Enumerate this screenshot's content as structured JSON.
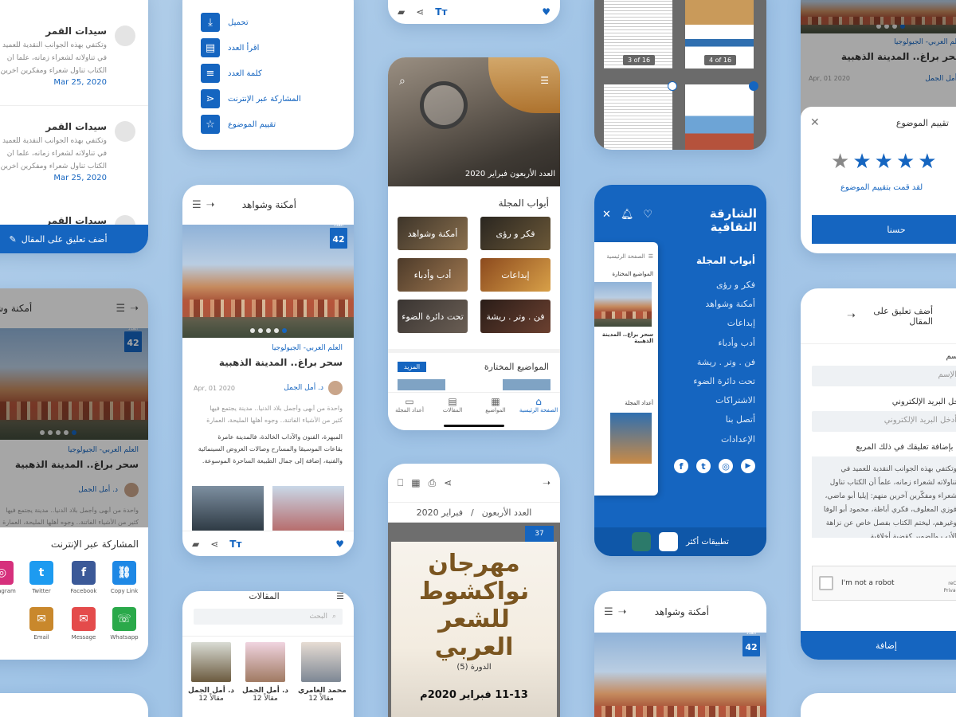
{
  "comments_card": {
    "comments": [
      {
        "name": "سيدات القمر",
        "text1": "وتكتفي بهذه الجوانب النقدية للعميد في",
        "text2": "في تناولاته لشعراء زمانه، علماً أن",
        "text3": "الكتاب تناول شعراء ومفكّرين آخرين",
        "date": "Mar 25, 2020"
      },
      {
        "name": "سيدات القمر",
        "text1": "وتكتفي بهذه الجوانب النقدية للعميد في",
        "text2": "في تناولاته لشعراء زمانه، علماً أن",
        "text3": "الكتاب تناول شعراء ومفكّرين آخرين",
        "date": "Mar 25, 2020"
      },
      {
        "name": "سيدات القمر"
      }
    ],
    "add_comment": "أضف تعليق على المقال"
  },
  "menu_card": {
    "items": [
      "تحميل",
      "اقرأ العدد",
      "كلمة العدد",
      "المشاركة عبر الإنترنت",
      "تقييم الموضوع"
    ]
  },
  "article_card": {
    "title": "أمكنة وشواهد",
    "badge_label": "العدد",
    "badge_number": "42",
    "category": "العلم العربي- الجيولوجيا",
    "headline": "سحر براغ.. المدينة الذهبية",
    "date": "Apr, 01 2020",
    "author": "د. أمل الجمل",
    "p1": "واحدة من أبهى وأجمل بلاد الدنيا.. مدينة يجتمع فيها",
    "p2": "كثير من الأشياء الفاتنة.. وجوه أهلها المليحة، العمارة",
    "p3": "المبهرة، الفنون والآداب الخالدة، فالمدينة عامرة",
    "p4": "بقاعات الموسيقا والمسارح وصالات العروض السينمائية",
    "p5": "والفنية، إضافة إلى جمال الطبيعة الساحرة الموسوعة."
  },
  "share_sheet": {
    "title": "المشاركة عبر الإنترنت",
    "items": [
      "Instagram",
      "Twitter",
      "Facebook",
      "Copy Link",
      "Email",
      "Message",
      "Whatsapp"
    ]
  },
  "home_card": {
    "hero_caption": "العدد الأربعون فبراير 2020",
    "sections_title": "أبواب المجلة",
    "tiles": [
      "فكر و رؤى",
      "أمكنة وشواهد",
      "إبداعات",
      "أدب وأدباء",
      "فن . وتر . ريشة",
      "تحت دائرة الضوء"
    ],
    "featured_title": "المواضيع المختارة",
    "more_label": "المزيد",
    "tabs": [
      "الصفحة الرئيسية",
      "المواضيع",
      "المقالات",
      "أعداد المجلة"
    ]
  },
  "drawer_card": {
    "logo": "الشارقة الثقافية",
    "section_title": "أبواب المجلة",
    "items": [
      "فكر و رؤى",
      "أمكنة وشواهد",
      "إبداعات",
      "أدب وأدباء",
      "فن . وتر . ريشة",
      "تحت دائرة الضوء",
      "الاشتراكات",
      "أتصل بنا",
      "الإعدادات"
    ],
    "more_apps": "تطبيقات أكثر",
    "preview_featured": "المواضيع المختارة",
    "preview_issues": "أعداد المجلة",
    "preview_home": "الصفحة الرئيسية"
  },
  "reader_card": {
    "issue": "العدد الأربعون",
    "month": "فبراير 2020",
    "poster_line1": "مهرجان",
    "poster_line2": "نواكشوط",
    "poster_line3": "للشعر",
    "poster_line4": "العربي",
    "poster_edition": "الدورة (5)",
    "poster_date": "11-13 فبراير 2020م"
  },
  "magazine_pages": {
    "page_a": "3 of 16",
    "page_b": "4 of 16"
  },
  "rating_card": {
    "title": "تقييم الموضوع",
    "stars_filled": 4,
    "stars_total": 5,
    "message": "لقد قمت بتقييم الموضوع",
    "ok": "حسنا"
  },
  "comment_form": {
    "title": "أضف تعليق على المقال",
    "name_label": "الإسم",
    "name_placeholder": "الإسم",
    "email_label": "أدخل البريد الإلكتروني",
    "email_placeholder": "أدخل البريد الإلكتروني",
    "comment_label": "قم بإضافة تعليقك في ذلك المربع",
    "comment_text": "وتكتفي بهذه الجوانب النقدية للعميد في تناولاته لشعراء زمانه، علماً أن الكتاب تناول شعراء ومفكّرين آخرين منهم: إيليا أبو ماضي، فوزي المعلوف، فكري أباظة، محمود أبو الوفا وغيرهم، ليختم الكتاب بفصل خاص عن نزاهة الأدب والضمير كقضية أخلاقية",
    "captcha": "I'm not a robot",
    "captcha_brand": "reCAPTCHA",
    "captcha_terms": "Privacy - Terms",
    "submit": "إضافة"
  },
  "authors_card": {
    "title": "المقالات",
    "search_placeholder": "البحث",
    "authors": [
      {
        "name": "محمد العامري",
        "count": "12 مقالاً"
      },
      {
        "name": "د. أمل الجمل",
        "count": "12 مقالاً"
      },
      {
        "name": "د. أمل الجمل",
        "count": "12 مقالاً"
      }
    ]
  },
  "colors": {
    "brand": "#1565c0",
    "background": "#a9c8e8"
  }
}
